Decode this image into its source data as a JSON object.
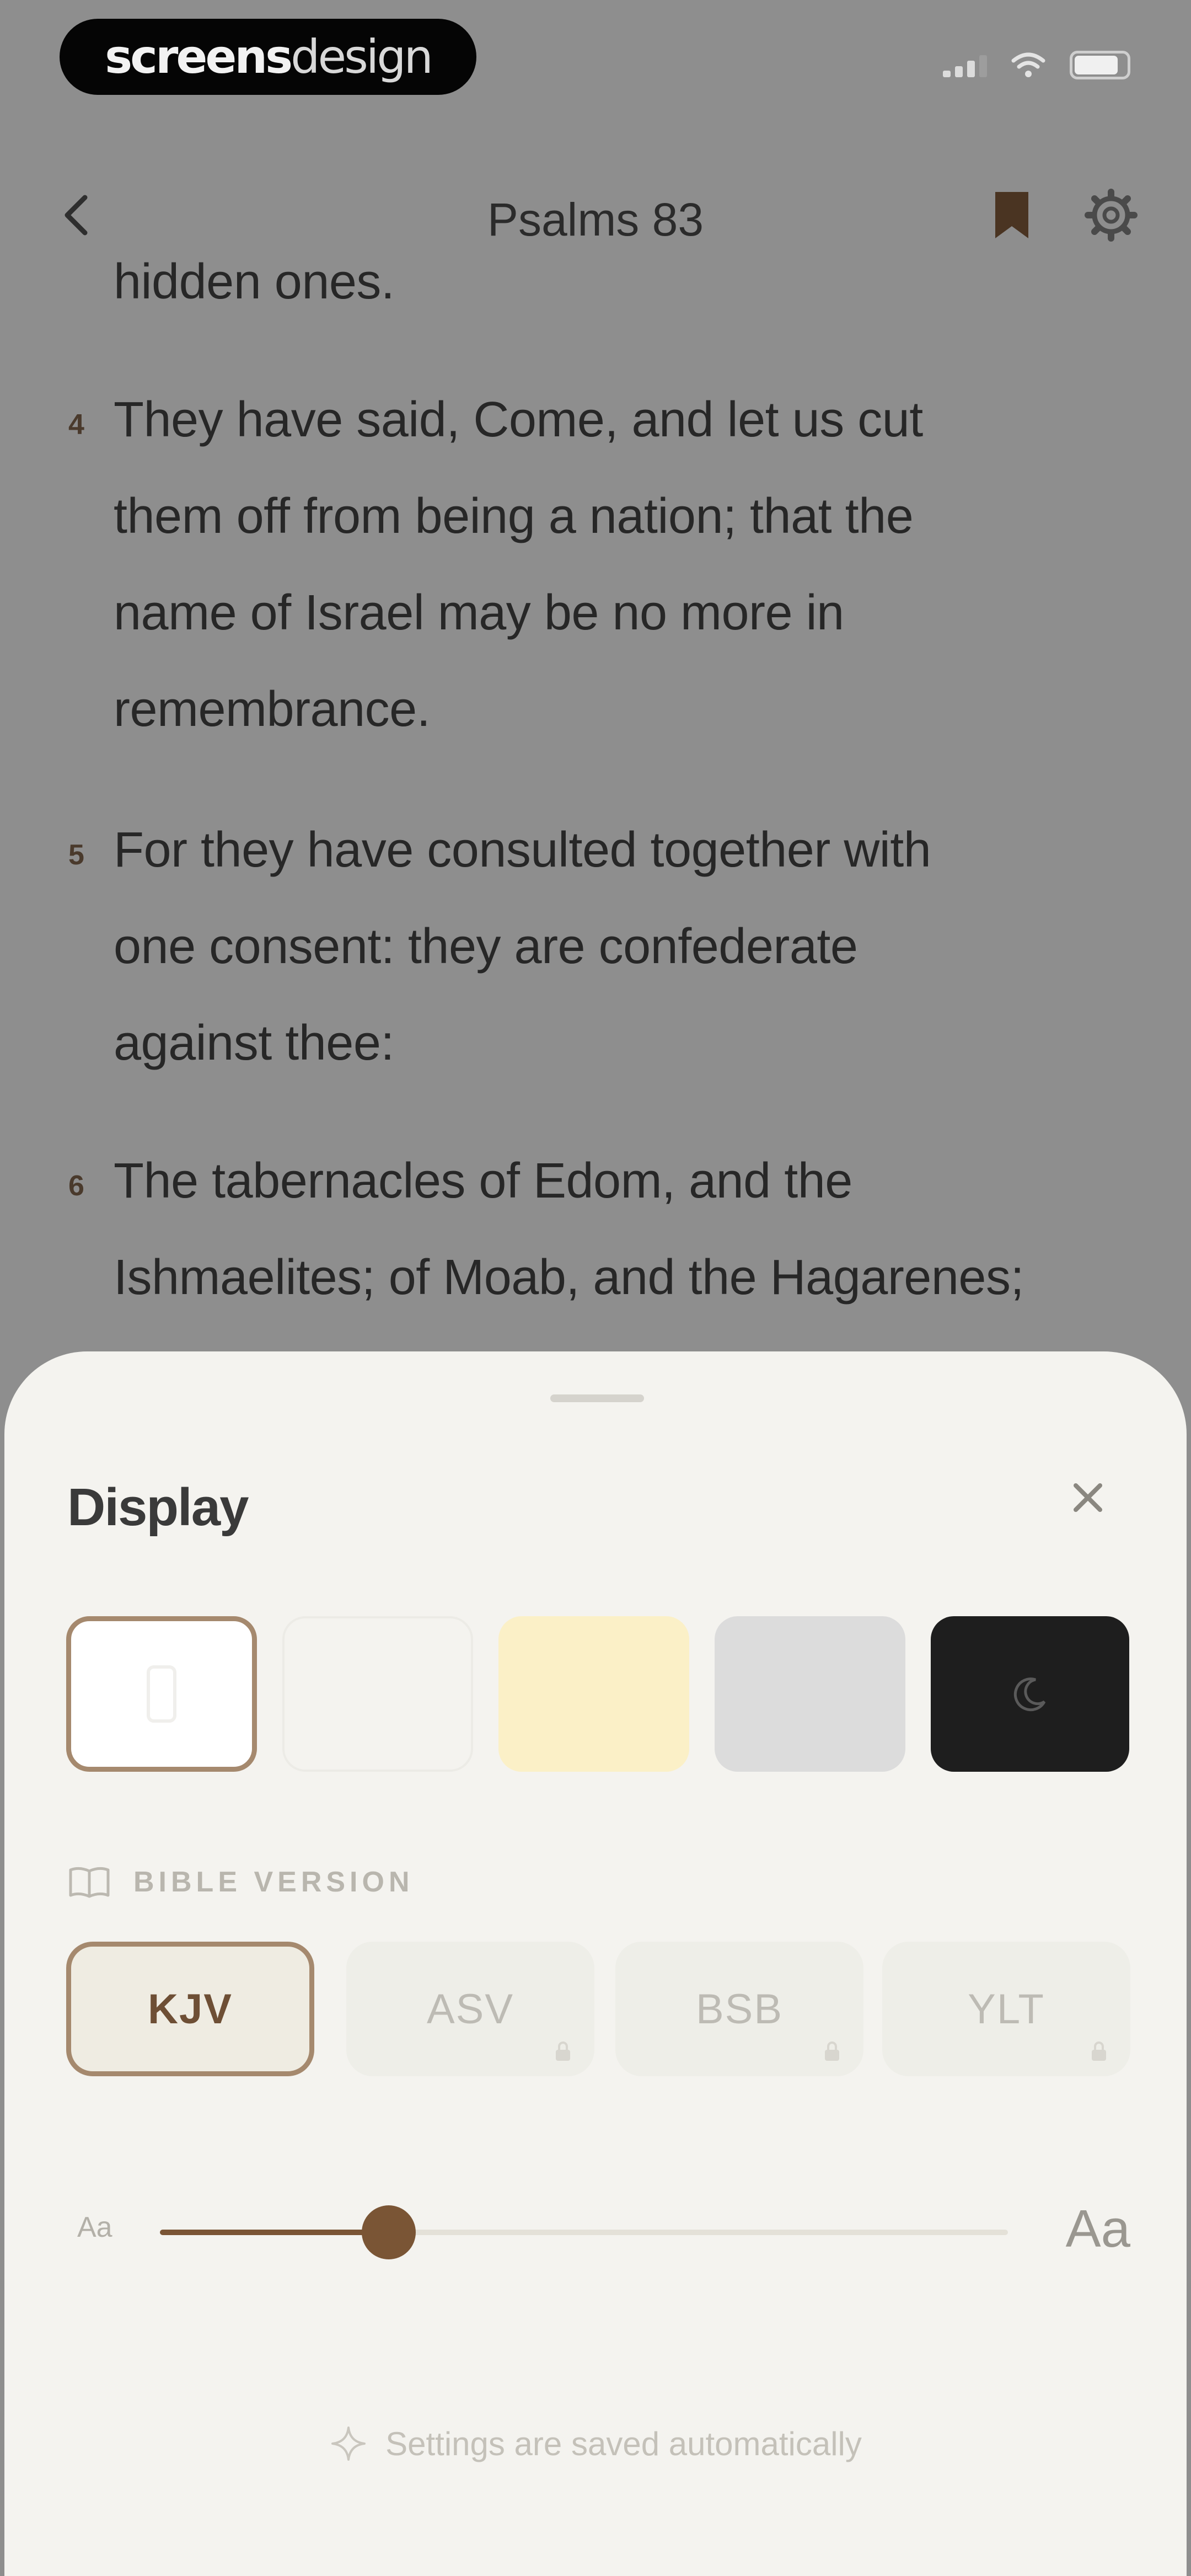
{
  "status_bar": {
    "brand_bold": "screens",
    "brand_light": "design"
  },
  "nav": {
    "title": "Psalms 83"
  },
  "reader": {
    "lines": [
      {
        "num": "",
        "text": "hidden ones."
      },
      {
        "num": "4",
        "text": "They have said, Come, and let us cut"
      },
      {
        "num": "",
        "text": "them off from being a nation; that the"
      },
      {
        "num": "",
        "text": "name of Israel may be no more in"
      },
      {
        "num": "",
        "text": "remembrance."
      },
      {
        "num": "5",
        "text": "For they have consulted together with"
      },
      {
        "num": "",
        "text": "one consent: they are confederate"
      },
      {
        "num": "",
        "text": "against thee:"
      },
      {
        "num": "6",
        "text": "The tabernacles of Edom, and the"
      },
      {
        "num": "",
        "text": "Ishmaelites; of Moab, and the Hagarenes;"
      }
    ]
  },
  "sheet": {
    "title": "Display",
    "themes": [
      {
        "name": "white",
        "color": "#ffffff",
        "selected": true
      },
      {
        "name": "off-white",
        "color": "#f4f3ef",
        "selected": false
      },
      {
        "name": "sepia",
        "color": "#fbf0c7",
        "selected": false
      },
      {
        "name": "gray",
        "color": "#dcdcdc",
        "selected": false
      },
      {
        "name": "dark",
        "color": "#1e1e1e",
        "selected": false,
        "icon": "moon-icon"
      }
    ],
    "version_label": "BIBLE VERSION",
    "versions": [
      {
        "label": "KJV",
        "selected": true,
        "locked": false
      },
      {
        "label": "ASV",
        "selected": false,
        "locked": true
      },
      {
        "label": "BSB",
        "selected": false,
        "locked": true
      },
      {
        "label": "YLT",
        "selected": false,
        "locked": true
      }
    ],
    "font_size": {
      "small_label": "Aa",
      "large_label": "Aa",
      "level": 0.27
    },
    "saved_note": "Settings are saved automatically"
  },
  "colors": {
    "accent": "#7a5535",
    "selected_border": "#a5896e",
    "sheet_bg": "#f4f3ef"
  }
}
